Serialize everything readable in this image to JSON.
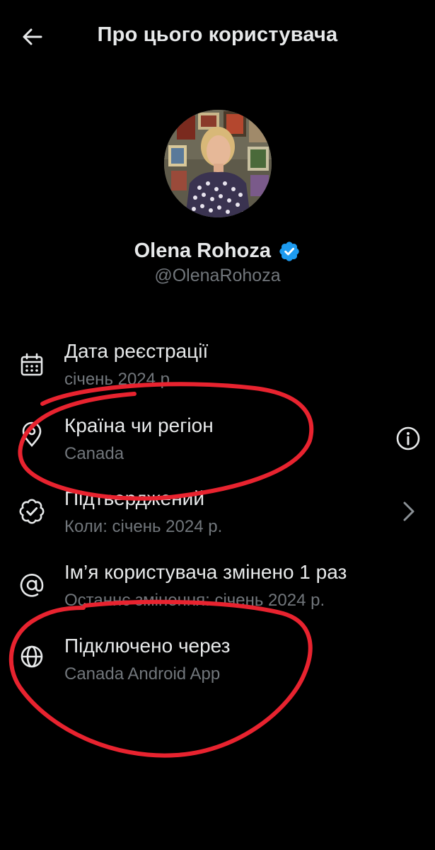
{
  "header": {
    "title": "Про цього користувача",
    "back_icon": "arrow-left-icon"
  },
  "profile": {
    "name": "Olena Rohoza",
    "handle": "@OlenaRohoza",
    "verified": true,
    "verified_color": "#1d9bf0"
  },
  "rows": [
    {
      "icon": "calendar-icon",
      "title": "Дата реєстрації",
      "subtitle": "січень 2024 р."
    },
    {
      "icon": "location-pin-icon",
      "title": "Країна чи регіон",
      "subtitle": "Canada",
      "action_icon": "info-icon"
    },
    {
      "icon": "verified-check-icon",
      "title": "Підтверджений",
      "subtitle": "Коли: січень 2024 р.",
      "action_icon": "chevron-right-icon"
    },
    {
      "icon": "at-sign-icon",
      "title": "Ім’я користувача змінено 1 раз",
      "subtitle": "Останнє змінення: січень 2024 р."
    },
    {
      "icon": "globe-icon",
      "title": "Підключено через",
      "subtitle": "Canada Android App"
    }
  ],
  "colors": {
    "background": "#000000",
    "primary_text": "#e7e9ea",
    "secondary_text": "#71767b",
    "annotation": "#e8232f"
  }
}
